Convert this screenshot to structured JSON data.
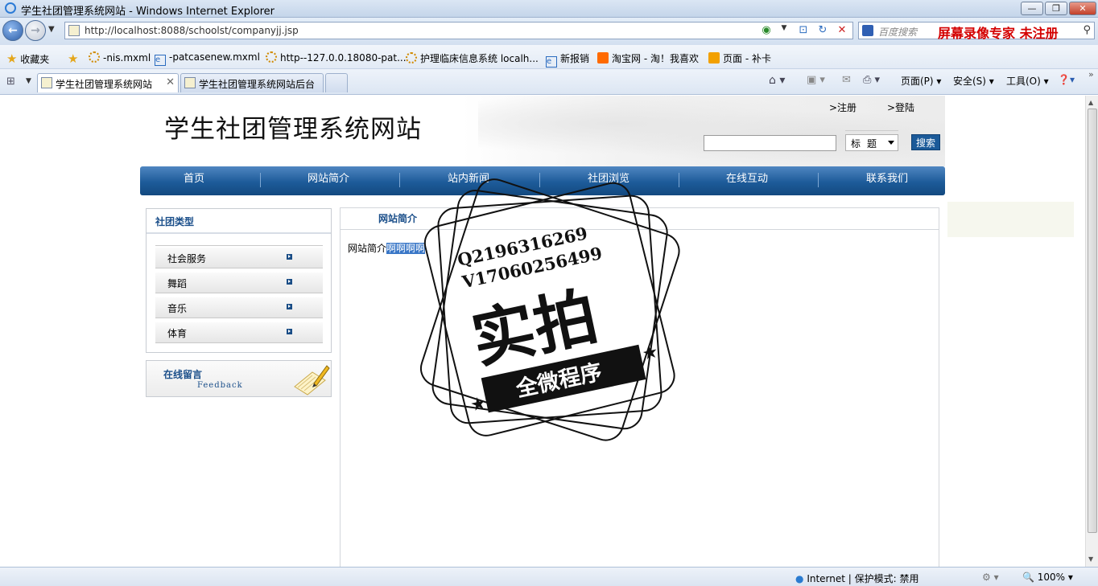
{
  "window": {
    "title": "学生社团管理系统网站 - Windows Internet Explorer",
    "controls": {
      "minimize": "—",
      "restore": "❐",
      "close": "✕"
    }
  },
  "address_bar": {
    "url": "http://localhost:8088/schoolst/companyjj.jsp",
    "search_placeholder": "百度搜索",
    "watermark_text": "屏幕录像专家  未注册"
  },
  "favorites_bar": {
    "favorites_label": "收藏夹",
    "items": [
      "-nis.mxml",
      "-patcasenew.mxml",
      "http--127.0.0.18080-pat...",
      "护理临床信息系统 localh...",
      "新报销",
      "淘宝网 - 淘！我喜欢",
      "页面 - 补卡"
    ]
  },
  "tabs": [
    {
      "label": "学生社团管理系统网站",
      "active": true
    },
    {
      "label": "学生社团管理系统网站后台",
      "active": false
    }
  ],
  "command_bar": {
    "page": "页面(P)",
    "safety": "安全(S)",
    "tools": "工具(O)"
  },
  "site": {
    "title": "学生社团管理系统网站",
    "register": ">注册",
    "login": ">登陆",
    "search_select": "标题",
    "search_button": "搜索",
    "nav": [
      "首页",
      "网站简介",
      "站内新闻",
      "社团浏览",
      "在线互动",
      "联系我们"
    ],
    "sidebar": {
      "title": "社团类型",
      "categories": [
        "社会服务",
        "舞蹈",
        "音乐",
        "体育"
      ]
    },
    "message": {
      "title": "在线留言",
      "subtitle": "Feedback"
    },
    "content": {
      "tab_title": "网站简介",
      "body_prefix": "网站简介",
      "body_highlight": "啊啊啊啊"
    }
  },
  "stamp": {
    "line1": "Q2196316269",
    "line2": "V17060256499",
    "big": "实拍",
    "banner": "全微程序"
  },
  "status_bar": {
    "zone": "Internet | 保护模式: 禁用",
    "zoom": "100%"
  }
}
